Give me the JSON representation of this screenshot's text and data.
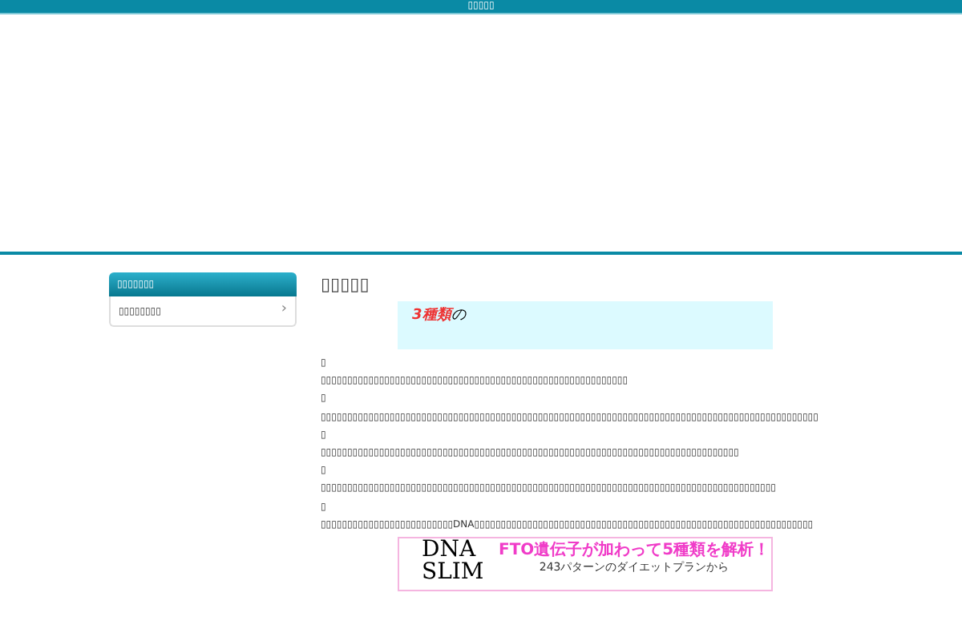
{
  "top_bar": {
    "title": "▯▯▯▯▯"
  },
  "sidebar": {
    "heading": "▯▯▯▯▯▯▯",
    "items": [
      {
        "label": "▯▯▯▯▯▯▯▯",
        "arrow": "›"
      }
    ]
  },
  "article": {
    "title": "▯▯▯▯▯",
    "callout": {
      "highlight": "3種類",
      "rest": "の"
    },
    "paragraphs": [
      "▯",
      "▯▯▯▯▯▯▯▯▯▯▯▯▯▯▯▯▯▯▯▯▯▯▯▯▯▯▯▯▯▯▯▯▯▯▯▯▯▯▯▯▯▯▯▯▯▯▯▯▯▯▯▯▯▯▯▯▯▯",
      "▯",
      "▯▯▯▯▯▯▯▯▯▯▯▯▯▯▯▯▯▯▯▯▯▯▯▯▯▯▯▯▯▯▯▯▯▯▯▯▯▯▯▯▯▯▯▯▯▯▯▯▯▯▯▯▯▯▯▯▯▯▯▯▯▯▯▯▯▯▯▯▯▯▯▯▯▯▯▯▯▯▯▯▯▯▯▯▯▯▯▯▯▯▯▯▯▯",
      "▯",
      "▯▯▯▯▯▯▯▯▯▯▯▯▯▯▯▯▯▯▯▯▯▯▯▯▯▯▯▯▯▯▯▯▯▯▯▯▯▯▯▯▯▯▯▯▯▯▯▯▯▯▯▯▯▯▯▯▯▯▯▯▯▯▯▯▯▯▯▯▯▯▯▯▯▯▯▯▯▯▯",
      "▯",
      "▯▯▯▯▯▯▯▯▯▯▯▯▯▯▯▯▯▯▯▯▯▯▯▯▯▯▯▯▯▯▯▯▯▯▯▯▯▯▯▯▯▯▯▯▯▯▯▯▯▯▯▯▯▯▯▯▯▯▯▯▯▯▯▯▯▯▯▯▯▯▯▯▯▯▯▯▯▯▯▯▯▯▯▯▯▯",
      "▯",
      "▯▯▯▯▯▯▯▯▯▯▯▯▯▯▯▯▯▯▯▯▯▯▯▯▯DNA▯▯▯▯▯▯▯▯▯▯▯▯▯▯▯▯▯▯▯▯▯▯▯▯▯▯▯▯▯▯▯▯▯▯▯▯▯▯▯▯▯▯▯▯▯▯▯▯▯▯▯▯▯▯▯▯▯▯▯▯▯▯▯▯"
    ],
    "banner": {
      "logo_top": "DNA",
      "logo_bottom": "SLIM",
      "headline": "FTO遺伝子が加わって5種類を解析！",
      "subline": "243パターンのダイエットプランから"
    }
  }
}
